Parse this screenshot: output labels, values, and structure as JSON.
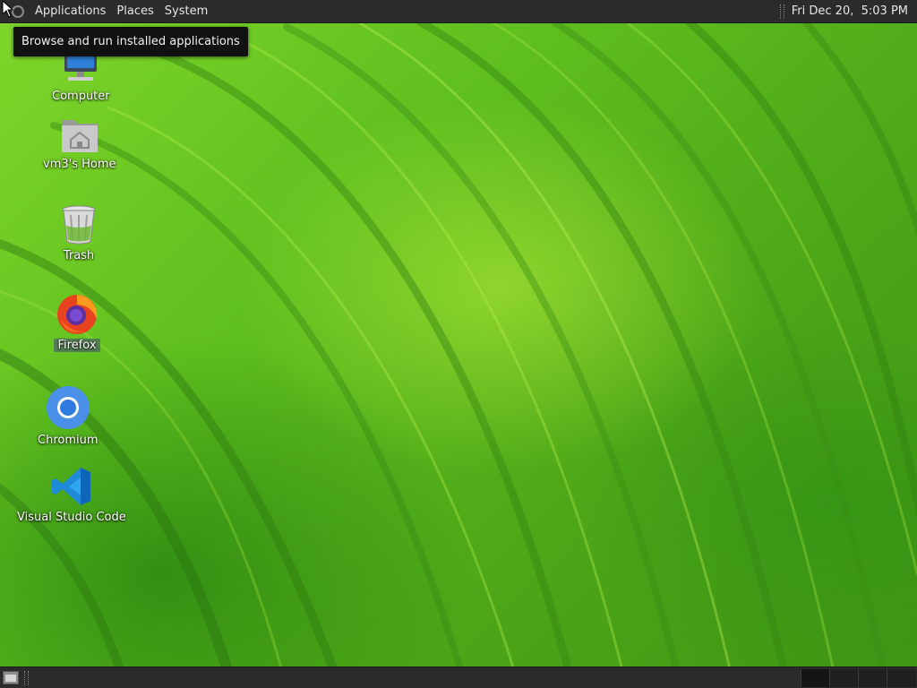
{
  "top_panel": {
    "menus": [
      "Applications",
      "Places",
      "System"
    ],
    "clock": "Fri Dec 20,  5:03 PM"
  },
  "tooltip": "Browse and run installed applications",
  "desktop_icons": [
    {
      "label": "Computer",
      "icon": "computer-icon"
    },
    {
      "label": "vm3's Home",
      "icon": "home-folder-icon"
    },
    {
      "label": "Trash",
      "icon": "trash-icon"
    },
    {
      "label": "Firefox",
      "icon": "firefox-icon",
      "selected": true
    },
    {
      "label": "Chromium",
      "icon": "chromium-icon"
    },
    {
      "label": "Visual Studio Code",
      "icon": "vscode-icon"
    }
  ],
  "bottom_panel": {
    "show_desktop_icon": "show-desktop-icon",
    "workspaces": 4
  },
  "colors": {
    "panel_bg": "#2b2b2b",
    "wallpaper_light": "#8fe030",
    "wallpaper_dark": "#2f7d0f",
    "tooltip_bg": "#111111"
  }
}
